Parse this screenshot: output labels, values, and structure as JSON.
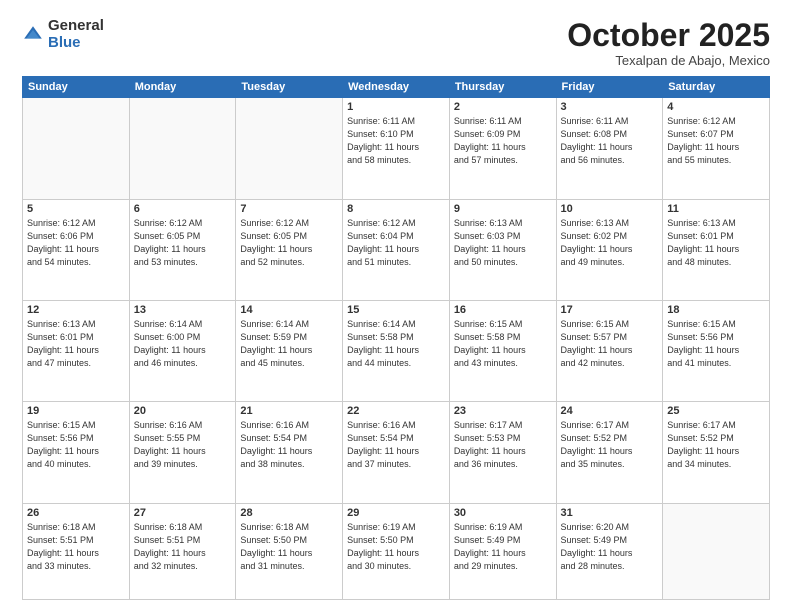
{
  "header": {
    "logo_general": "General",
    "logo_blue": "Blue",
    "month_title": "October 2025",
    "subtitle": "Texalpan de Abajo, Mexico"
  },
  "weekdays": [
    "Sunday",
    "Monday",
    "Tuesday",
    "Wednesday",
    "Thursday",
    "Friday",
    "Saturday"
  ],
  "weeks": [
    [
      {
        "day": "",
        "info": ""
      },
      {
        "day": "",
        "info": ""
      },
      {
        "day": "",
        "info": ""
      },
      {
        "day": "1",
        "info": "Sunrise: 6:11 AM\nSunset: 6:10 PM\nDaylight: 11 hours\nand 58 minutes."
      },
      {
        "day": "2",
        "info": "Sunrise: 6:11 AM\nSunset: 6:09 PM\nDaylight: 11 hours\nand 57 minutes."
      },
      {
        "day": "3",
        "info": "Sunrise: 6:11 AM\nSunset: 6:08 PM\nDaylight: 11 hours\nand 56 minutes."
      },
      {
        "day": "4",
        "info": "Sunrise: 6:12 AM\nSunset: 6:07 PM\nDaylight: 11 hours\nand 55 minutes."
      }
    ],
    [
      {
        "day": "5",
        "info": "Sunrise: 6:12 AM\nSunset: 6:06 PM\nDaylight: 11 hours\nand 54 minutes."
      },
      {
        "day": "6",
        "info": "Sunrise: 6:12 AM\nSunset: 6:05 PM\nDaylight: 11 hours\nand 53 minutes."
      },
      {
        "day": "7",
        "info": "Sunrise: 6:12 AM\nSunset: 6:05 PM\nDaylight: 11 hours\nand 52 minutes."
      },
      {
        "day": "8",
        "info": "Sunrise: 6:12 AM\nSunset: 6:04 PM\nDaylight: 11 hours\nand 51 minutes."
      },
      {
        "day": "9",
        "info": "Sunrise: 6:13 AM\nSunset: 6:03 PM\nDaylight: 11 hours\nand 50 minutes."
      },
      {
        "day": "10",
        "info": "Sunrise: 6:13 AM\nSunset: 6:02 PM\nDaylight: 11 hours\nand 49 minutes."
      },
      {
        "day": "11",
        "info": "Sunrise: 6:13 AM\nSunset: 6:01 PM\nDaylight: 11 hours\nand 48 minutes."
      }
    ],
    [
      {
        "day": "12",
        "info": "Sunrise: 6:13 AM\nSunset: 6:01 PM\nDaylight: 11 hours\nand 47 minutes."
      },
      {
        "day": "13",
        "info": "Sunrise: 6:14 AM\nSunset: 6:00 PM\nDaylight: 11 hours\nand 46 minutes."
      },
      {
        "day": "14",
        "info": "Sunrise: 6:14 AM\nSunset: 5:59 PM\nDaylight: 11 hours\nand 45 minutes."
      },
      {
        "day": "15",
        "info": "Sunrise: 6:14 AM\nSunset: 5:58 PM\nDaylight: 11 hours\nand 44 minutes."
      },
      {
        "day": "16",
        "info": "Sunrise: 6:15 AM\nSunset: 5:58 PM\nDaylight: 11 hours\nand 43 minutes."
      },
      {
        "day": "17",
        "info": "Sunrise: 6:15 AM\nSunset: 5:57 PM\nDaylight: 11 hours\nand 42 minutes."
      },
      {
        "day": "18",
        "info": "Sunrise: 6:15 AM\nSunset: 5:56 PM\nDaylight: 11 hours\nand 41 minutes."
      }
    ],
    [
      {
        "day": "19",
        "info": "Sunrise: 6:15 AM\nSunset: 5:56 PM\nDaylight: 11 hours\nand 40 minutes."
      },
      {
        "day": "20",
        "info": "Sunrise: 6:16 AM\nSunset: 5:55 PM\nDaylight: 11 hours\nand 39 minutes."
      },
      {
        "day": "21",
        "info": "Sunrise: 6:16 AM\nSunset: 5:54 PM\nDaylight: 11 hours\nand 38 minutes."
      },
      {
        "day": "22",
        "info": "Sunrise: 6:16 AM\nSunset: 5:54 PM\nDaylight: 11 hours\nand 37 minutes."
      },
      {
        "day": "23",
        "info": "Sunrise: 6:17 AM\nSunset: 5:53 PM\nDaylight: 11 hours\nand 36 minutes."
      },
      {
        "day": "24",
        "info": "Sunrise: 6:17 AM\nSunset: 5:52 PM\nDaylight: 11 hours\nand 35 minutes."
      },
      {
        "day": "25",
        "info": "Sunrise: 6:17 AM\nSunset: 5:52 PM\nDaylight: 11 hours\nand 34 minutes."
      }
    ],
    [
      {
        "day": "26",
        "info": "Sunrise: 6:18 AM\nSunset: 5:51 PM\nDaylight: 11 hours\nand 33 minutes."
      },
      {
        "day": "27",
        "info": "Sunrise: 6:18 AM\nSunset: 5:51 PM\nDaylight: 11 hours\nand 32 minutes."
      },
      {
        "day": "28",
        "info": "Sunrise: 6:18 AM\nSunset: 5:50 PM\nDaylight: 11 hours\nand 31 minutes."
      },
      {
        "day": "29",
        "info": "Sunrise: 6:19 AM\nSunset: 5:50 PM\nDaylight: 11 hours\nand 30 minutes."
      },
      {
        "day": "30",
        "info": "Sunrise: 6:19 AM\nSunset: 5:49 PM\nDaylight: 11 hours\nand 29 minutes."
      },
      {
        "day": "31",
        "info": "Sunrise: 6:20 AM\nSunset: 5:49 PM\nDaylight: 11 hours\nand 28 minutes."
      },
      {
        "day": "",
        "info": ""
      }
    ]
  ]
}
